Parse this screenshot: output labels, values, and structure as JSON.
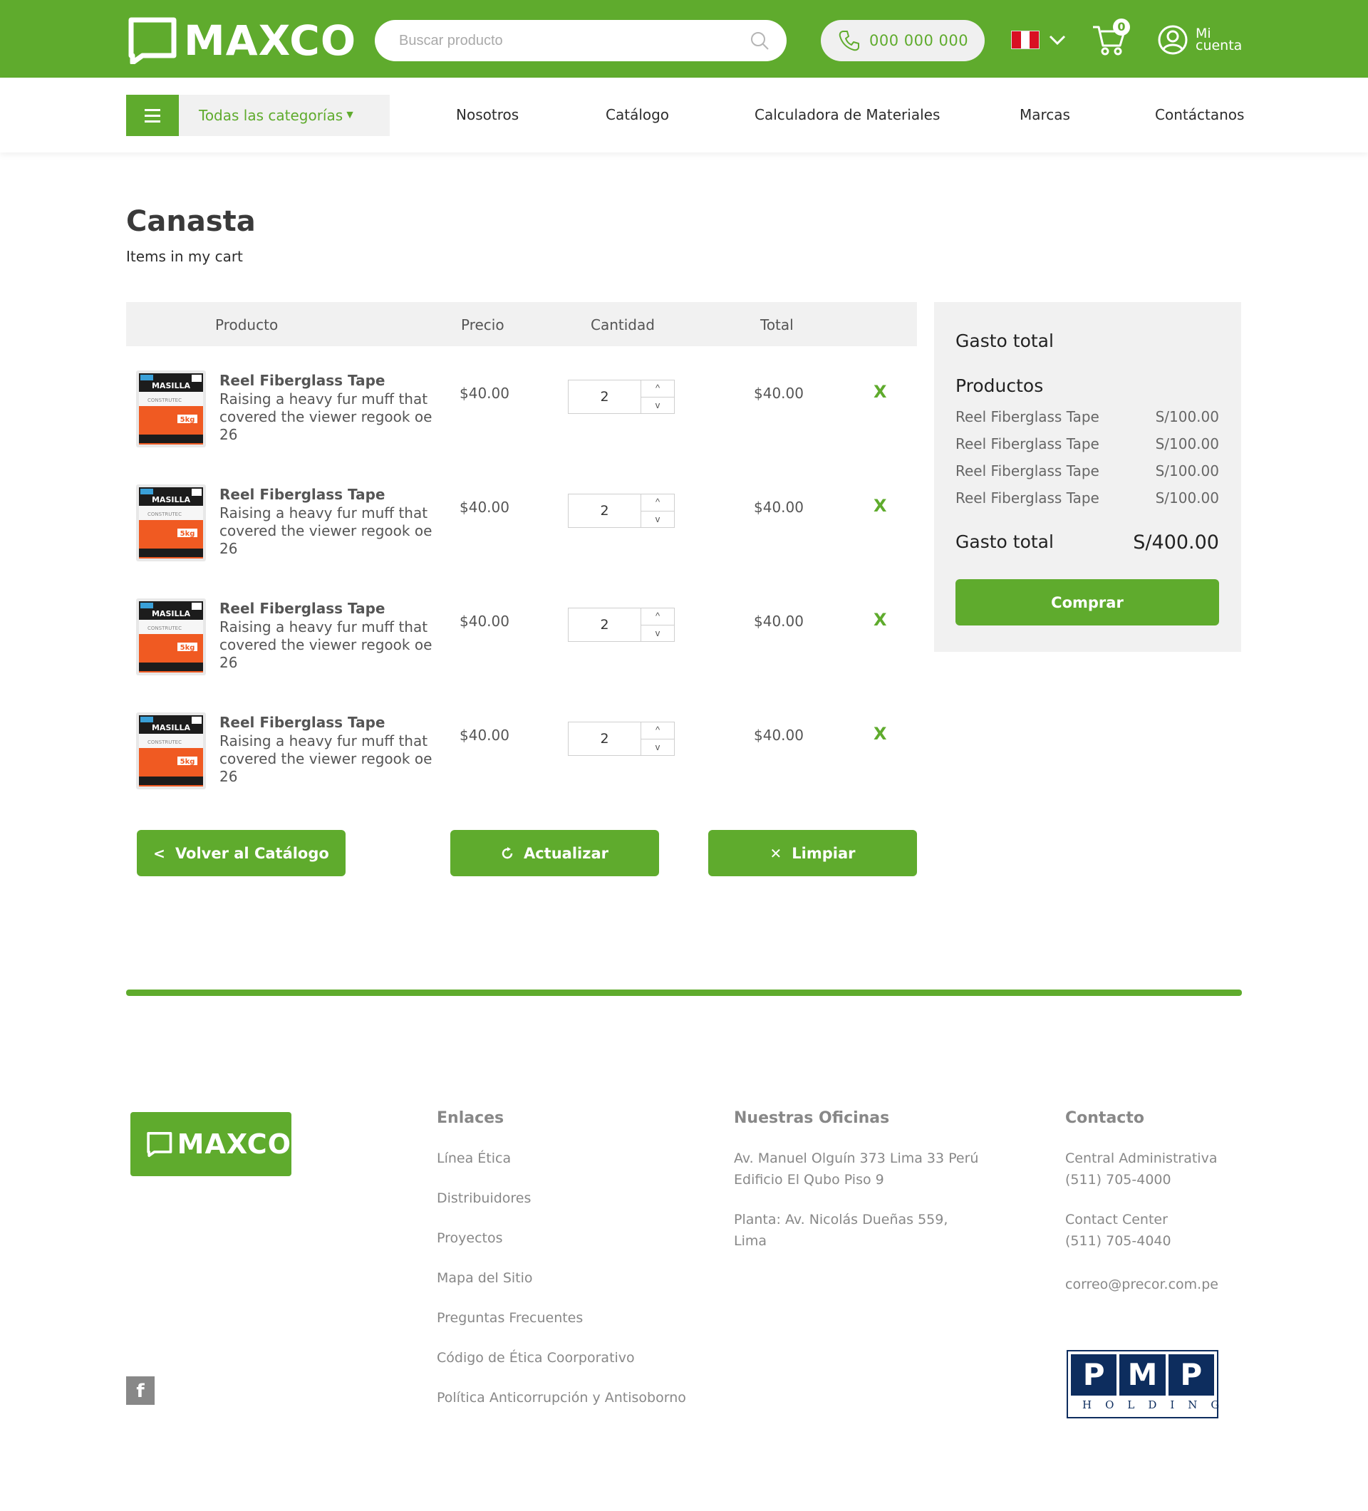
{
  "header": {
    "logo_text": "MAXCO",
    "search_placeholder": "Buscar producto",
    "phone": "000 000 000",
    "cart_count": "0",
    "account_line1": "Mi",
    "account_line2": "cuenta",
    "flag_colors": [
      "#d91023",
      "#ffffff",
      "#d91023"
    ]
  },
  "nav": {
    "categories_label": "Todas las categorías",
    "links": [
      "Nosotros",
      "Catálogo",
      "Calculadora de Materiales",
      "Marcas",
      "Contáctanos"
    ]
  },
  "page": {
    "title": "Canasta",
    "subtitle": "Items in my cart"
  },
  "table": {
    "headers": [
      "Producto",
      "Precio",
      "Cantidad",
      "Total"
    ],
    "rows": [
      {
        "name": "Reel Fiberglass Tape",
        "desc": "Raising a heavy fur muff that covered the viewer regook oe 26",
        "price": "$40.00",
        "qty": "2",
        "total": "$40.00",
        "remove": "X"
      },
      {
        "name": "Reel Fiberglass Tape",
        "desc": "Raising a heavy fur muff that covered the viewer regook oe 26",
        "price": "$40.00",
        "qty": "2",
        "total": "$40.00",
        "remove": "X"
      },
      {
        "name": "Reel Fiberglass Tape",
        "desc": "Raising a heavy fur muff that covered the viewer regook oe 26",
        "price": "$40.00",
        "qty": "2",
        "total": "$40.00",
        "remove": "X"
      },
      {
        "name": "Reel Fiberglass Tape",
        "desc": "Raising a heavy fur muff that covered the viewer regook oe 26",
        "price": "$40.00",
        "qty": "2",
        "total": "$40.00",
        "remove": "X"
      }
    ],
    "product_image": {
      "brand": "MASILLA",
      "sub": "CONSTRUTEC",
      "weight": "5kg"
    }
  },
  "actions": {
    "back_label": "Volver al Catálogo",
    "update_label": "Actualizar",
    "clear_label": "Limpiar"
  },
  "summary": {
    "title": "Gasto total",
    "products_title": "Productos",
    "items": [
      {
        "name": "Reel Fiberglass Tape",
        "amount": "S/100.00"
      },
      {
        "name": "Reel Fiberglass Tape",
        "amount": "S/100.00"
      },
      {
        "name": "Reel Fiberglass Tape",
        "amount": "S/100.00"
      },
      {
        "name": "Reel Fiberglass Tape",
        "amount": "S/100.00"
      }
    ],
    "total_label": "Gasto total",
    "total_amount": "S/400.00",
    "buy_label": "Comprar"
  },
  "footer": {
    "logo_text": "MAXCO",
    "links_title": "Enlaces",
    "links": [
      "Línea Ética",
      "Distribuidores",
      "Proyectos",
      "Mapa del Sitio",
      "Preguntas Frecuentes",
      "Código de Ética Coorporativo",
      "Política Anticorrupción y Antisoborno"
    ],
    "offices_title": "Nuestras Oficinas",
    "office1_line1": "Av. Manuel Olguín 373 Lima 33 Perú",
    "office1_line2": "Edificio El Qubo Piso 9",
    "office2_line1": "Planta: Av. Nicolás Dueñas 559,",
    "office2_line2": "Lima",
    "contact_title": "Contacto",
    "contact1_label": "Central Administrativa",
    "contact1_phone": "(511) 705-4000",
    "contact2_label": "Contact Center",
    "contact2_phone": "(511) 705-4040",
    "email": "correo@precor.com.pe",
    "facebook": "f",
    "pmp_letters": [
      "P",
      "M",
      "P"
    ],
    "pmp_word": "HOLDING"
  },
  "colors": {
    "brand_green": "#5fab2d",
    "panel_gray": "#f1f1f1",
    "pmp_navy": "#0d2d5e"
  }
}
